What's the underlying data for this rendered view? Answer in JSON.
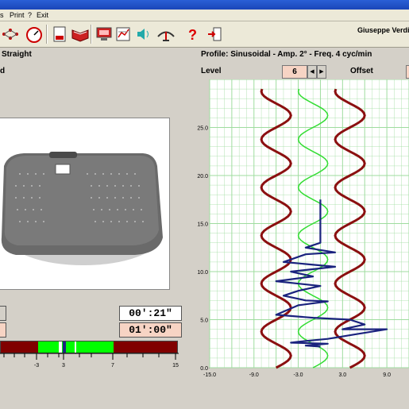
{
  "menu": {
    "items": [
      "s",
      "Print",
      "?",
      "Exit"
    ]
  },
  "header": {
    "user": "Giuseppe Verdi"
  },
  "left": {
    "mode_label": "Straight",
    "sub_label": "d",
    "elapsed_time": "00':21\"",
    "total_time": "01':00\"",
    "scale_labels": [
      "-3",
      "3",
      "7",
      "15"
    ]
  },
  "right": {
    "profile": "Profile: Sinusoidal - Amp. 2° - Freq. 4 cyc/min",
    "level_label": "Level",
    "level_value": "6",
    "offset_label": "Offset"
  },
  "chart_data": {
    "type": "line",
    "x_ticks": [
      "-15.0",
      "-9.0",
      "-3.0",
      "3.0",
      "9.0"
    ],
    "y_ticks": [
      "0.0",
      "5.0",
      "10.0",
      "15.0",
      "20.0",
      "25.0"
    ],
    "xlim": [
      -15,
      12
    ],
    "ylim": [
      0,
      30
    ],
    "series": [
      {
        "role": "limit-left",
        "color": "#8b1010",
        "center": -6,
        "amp": 2,
        "freq": 0.2,
        "y": [
          0,
          29
        ]
      },
      {
        "role": "limit-right",
        "color": "#8b1010",
        "center": 4,
        "amp": 2,
        "freq": 0.2,
        "y": [
          0,
          29
        ]
      },
      {
        "role": "target",
        "color": "#33dd33",
        "center": -1,
        "amp": 2,
        "freq": 0.2,
        "y": [
          0,
          29
        ]
      },
      {
        "role": "trace",
        "color": "#1a237e",
        "points": [
          [
            0,
            17.5
          ],
          [
            0,
            13
          ],
          [
            -2,
            12.5
          ],
          [
            2,
            12
          ],
          [
            -2,
            11.8
          ],
          [
            -5,
            11
          ],
          [
            2,
            10.5
          ],
          [
            -4,
            10
          ],
          [
            -1,
            9.5
          ],
          [
            -6,
            9
          ],
          [
            0,
            8.5
          ],
          [
            -3,
            8
          ],
          [
            -5,
            7.5
          ],
          [
            -2,
            7
          ],
          [
            1,
            6.9
          ],
          [
            -3,
            6.5
          ],
          [
            -6,
            5.5
          ],
          [
            -1,
            5.2
          ],
          [
            4,
            5
          ],
          [
            6,
            4.5
          ],
          [
            3,
            4
          ],
          [
            9,
            4
          ],
          [
            5,
            3.5
          ],
          [
            1,
            3
          ],
          [
            -3,
            2.7
          ],
          [
            -4,
            2.6
          ],
          [
            1,
            2.5
          ],
          [
            -2,
            2.3
          ],
          [
            0,
            2.2
          ]
        ]
      }
    ]
  },
  "colors": {
    "accent": "#2a5fd6",
    "level_box": "#f7d4c4",
    "bar_red": "#800000",
    "bar_green": "#00ff00"
  },
  "toolbar": {
    "icons": [
      "printer-icon",
      "gauge-icon",
      "clipboard-icon",
      "book-icon",
      "monitor-icon",
      "chart-edit-icon",
      "speaker-icon",
      "balance-icon",
      "help-icon",
      "exit-icon"
    ]
  }
}
